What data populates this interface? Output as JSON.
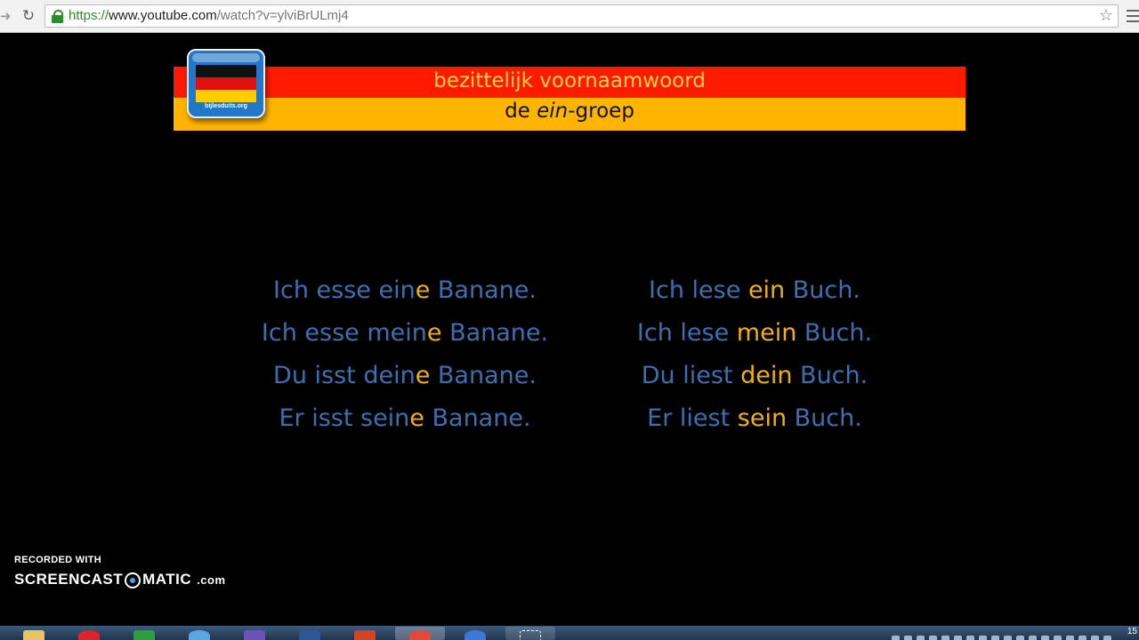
{
  "browser": {
    "url_scheme": "https://",
    "url_host": "www.youtube.com",
    "url_path": "/watch?v=ylviBrULmj4",
    "star_icon": "star-icon",
    "reload_icon": "reload-icon"
  },
  "slide": {
    "title": "bezittelijk voornaamwoord",
    "subtitle_pre": "de ",
    "subtitle_em": "ein",
    "subtitle_post": "-groep",
    "logo_caption": "bijlesduits.org",
    "left_column": [
      {
        "pre": "Ich esse ein",
        "hl": "e",
        "post": " Banane."
      },
      {
        "pre": "Ich esse mein",
        "hl": "e",
        "post": " Banane."
      },
      {
        "pre": "Du isst dein",
        "hl": "e",
        "post": " Banane."
      },
      {
        "pre": "Er isst sein",
        "hl": "e",
        "post": " Banane."
      }
    ],
    "right_column": [
      {
        "pre": "Ich lese ",
        "hl": "ein",
        "post": " Buch."
      },
      {
        "pre": "Ich lese ",
        "hl": "mein",
        "post": " Buch."
      },
      {
        "pre": "Du liest ",
        "hl": "dein",
        "post": " Buch."
      },
      {
        "pre": "Er liest ",
        "hl": "sein",
        "post": " Buch."
      }
    ],
    "colors": {
      "red_band": "#ff1a00",
      "yellow_band": "#ffb400",
      "text_blue": "#3d6fb0",
      "highlight": "#f0b010"
    }
  },
  "watermark": {
    "line1": "RECORDED WITH",
    "brand_a": "SCREENCAST",
    "brand_b": "MATIC",
    "site": ".com"
  },
  "taskbar": {
    "clock": "15"
  }
}
